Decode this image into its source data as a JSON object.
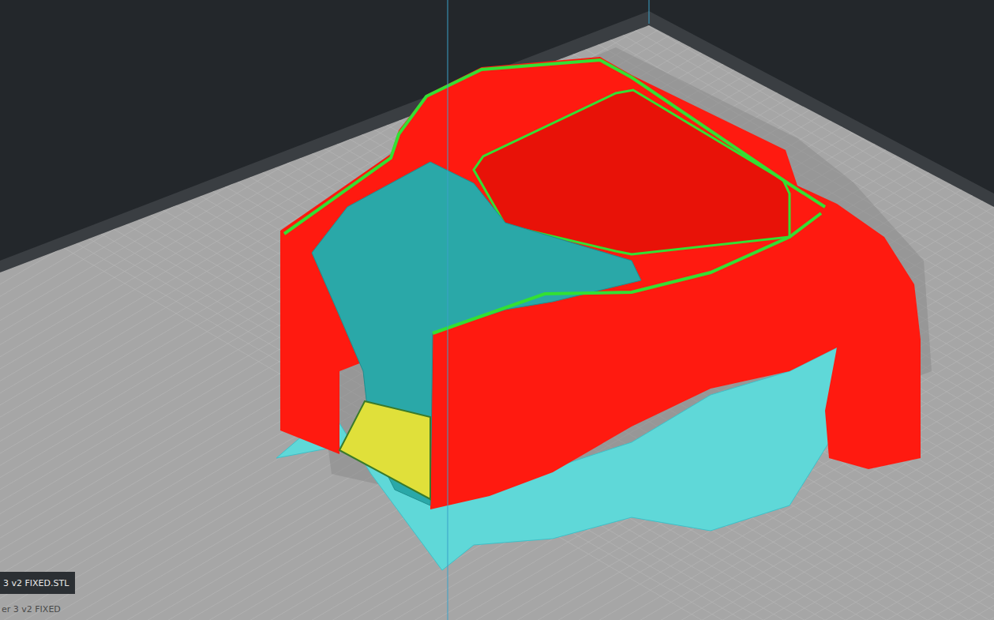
{
  "file_label": "3 v2 FIXED.STL",
  "object_label": "er 3 v2 FIXED"
}
